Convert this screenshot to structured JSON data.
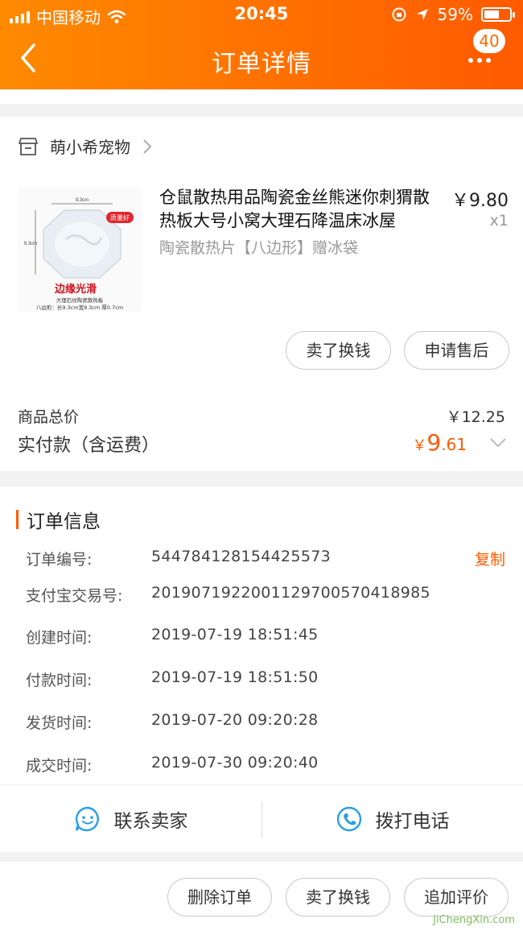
{
  "status": {
    "carrier": "中国移动",
    "time": "20:45",
    "battery": "59%",
    "battery_level": 0.59
  },
  "nav": {
    "title": "订单详情",
    "badge": "40"
  },
  "shop": {
    "name": "萌小希宠物"
  },
  "product": {
    "title": "仓鼠散热用品陶瓷金丝熊迷你刺猬散热板大号小窝大理石降温床冰屋",
    "spec": "陶瓷散热片【八边形】赠冰袋",
    "price": "￥9.80",
    "qty": "x1",
    "image_text": {
      "size_top": "9.3cm",
      "size_side": "9.3cm",
      "tag": "质量好",
      "slogan": "边缘光滑",
      "caption1": "大理石纹陶瓷散热板",
      "caption2": "八边形：长9.3cm宽9.3cm 厚0.7cm"
    }
  },
  "actions": {
    "sell": "卖了换钱",
    "aftersale": "申请售后"
  },
  "totals": {
    "goods_label": "商品总价",
    "goods_value": "￥12.25",
    "paid_label": "实付款（含运费）",
    "paid_currency": "￥",
    "paid_int": "9",
    "paid_dec": ".61"
  },
  "order_info": {
    "heading": "订单信息",
    "copy_label": "复制",
    "rows": [
      {
        "key": "订单编号:",
        "value": "544784128154425573"
      },
      {
        "key": "支付宝交易号:",
        "value": "2019071922001129700570418985"
      },
      {
        "key": "创建时间:",
        "value": "2019-07-19 18:51:45"
      },
      {
        "key": "付款时间:",
        "value": "2019-07-19 18:51:50"
      },
      {
        "key": "发货时间:",
        "value": "2019-07-20 09:20:28"
      },
      {
        "key": "成交时间:",
        "value": "2019-07-30 09:20:40"
      }
    ]
  },
  "contact": {
    "seller": "联系卖家",
    "phone": "拨打电话"
  },
  "bottom": {
    "delete": "删除订单",
    "sell": "卖了换钱",
    "review": "追加评价"
  },
  "watermark": "JiChengXin.com",
  "colors": {
    "accent": "#ff5a00",
    "header_from": "#ff8a00",
    "header_to": "#ff5a00",
    "contact_icon": "#2a9fe6"
  }
}
